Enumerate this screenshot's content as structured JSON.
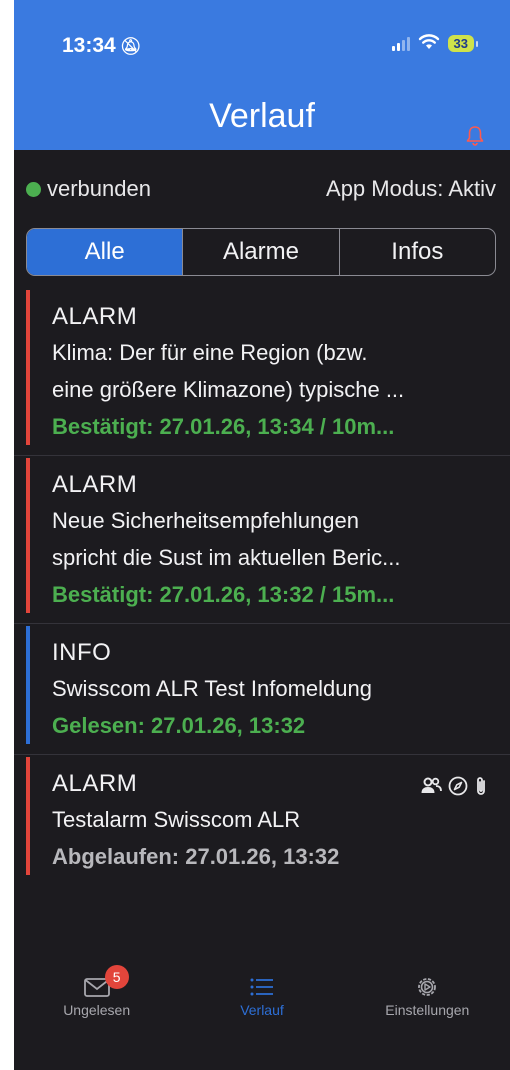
{
  "status_bar": {
    "time": "13:34",
    "battery": "33"
  },
  "header": {
    "title": "Verlauf"
  },
  "connection": {
    "status": "verbunden",
    "mode": "App Modus: Aktiv"
  },
  "tabs": [
    {
      "label": "Alle",
      "active": true
    },
    {
      "label": "Alarme",
      "active": false
    },
    {
      "label": "Infos",
      "active": false
    }
  ],
  "items": [
    {
      "type": "ALARM",
      "text_line1": "Klima: Der für eine Region (bzw.",
      "text_line2": "eine größere Klimazone) typische ...",
      "status": "Bestätigt: 27.01.26, 13:34 / 10m...",
      "status_color": "#4caf50",
      "bar_color": "#e2453b"
    },
    {
      "type": "ALARM",
      "text_line1": "Neue Sicherheitsempfehlungen",
      "text_line2": "spricht die Sust im aktuellen Beric...",
      "status": "Bestätigt: 27.01.26, 13:32 / 15m...",
      "status_color": "#4caf50",
      "bar_color": "#e2453b"
    },
    {
      "type": "INFO",
      "text_line1": "Swisscom ALR Test Infomeldung",
      "status": "Gelesen: 27.01.26, 13:32",
      "status_color": "#4caf50",
      "bar_color": "#2d6fd6"
    },
    {
      "type": "ALARM",
      "text_line1": "Testalarm Swisscom ALR",
      "status": "Abgelaufen: 27.01.26, 13:32",
      "status_color": "#b8b8bc",
      "bar_color": "#e2453b",
      "icons": [
        "group-icon",
        "compass-icon",
        "attachment-icon"
      ]
    }
  ],
  "bottom_nav": {
    "unread": {
      "label": "Ungelesen",
      "badge": "5"
    },
    "history": {
      "label": "Verlauf"
    },
    "settings": {
      "label": "Einstellungen"
    }
  },
  "colors": {
    "accent": "#3a7ae0",
    "alarm": "#e2453b",
    "ok": "#4caf50",
    "background": "#1c1b1f"
  }
}
